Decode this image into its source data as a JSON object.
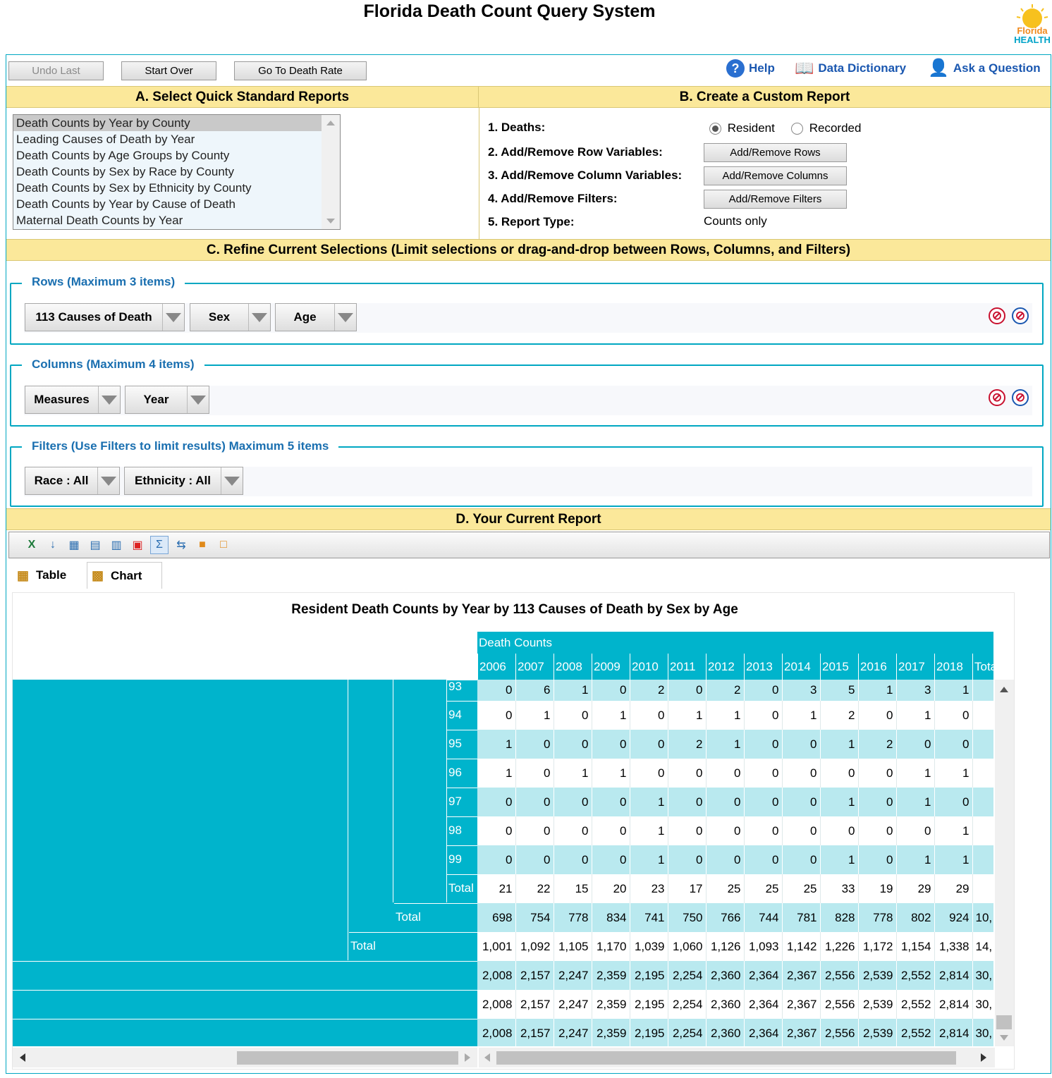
{
  "app": {
    "title": "Florida Death Count Query System",
    "logo_text_1": "Florida",
    "logo_text_2": "HEALTH"
  },
  "toolbar": {
    "undo_label": "Undo Last",
    "start_over_label": "Start Over",
    "death_rate_label": "Go To Death Rate",
    "help_label": "Help",
    "dictionary_label": "Data Dictionary",
    "ask_label": "Ask a Question"
  },
  "sectionA": {
    "header": "A. Select Quick Standard Reports",
    "reports": [
      "Death Counts by Year by County",
      "Leading Causes of Death by Year",
      "Death Counts by Age Groups by County",
      "Death Counts by Sex by Race by County",
      "Death Counts by Sex by Ethnicity by County",
      "Death Counts by Year by Cause of Death",
      "Maternal Death Counts by Year"
    ]
  },
  "sectionB": {
    "header": "B. Create a Custom Report",
    "deaths_label": "1. Deaths:",
    "resident_label": "Resident",
    "recorded_label": "Recorded",
    "rows_label": "2. Add/Remove Row Variables:",
    "rows_button": "Add/Remove Rows",
    "columns_label": "3. Add/Remove Column Variables:",
    "columns_button": "Add/Remove Columns",
    "filters_label": "4. Add/Remove Filters:",
    "filters_button": "Add/Remove Filters",
    "report_type_label": "5. Report Type:",
    "report_type_value": "Counts only"
  },
  "sectionC": {
    "header": "C. Refine Current Selections (Limit selections or drag-and-drop between Rows, Columns, and Filters)",
    "rows_legend": "Rows (Maximum 3 items)",
    "row_chips": [
      "113 Causes of Death",
      "Sex",
      "Age"
    ],
    "columns_legend": "Columns (Maximum 4 items)",
    "column_chips": [
      "Measures",
      "Year"
    ],
    "filters_legend": "Filters (Use Filters to limit results) Maximum 5 items",
    "filter_chips": [
      "Race : All",
      "Ethnicity : All"
    ]
  },
  "sectionD": {
    "header": "D. Your Current Report",
    "tab_table": "Table",
    "tab_chart": "Chart",
    "report_title": "Resident Death Counts by Year by 113 Causes of Death by Sex by Age",
    "measure_header": "Death Counts",
    "years": [
      "2006",
      "2007",
      "2008",
      "2009",
      "2010",
      "2011",
      "2012",
      "2013",
      "2014",
      "2015",
      "2016",
      "2017",
      "2018",
      "Tota"
    ],
    "rows": [
      {
        "label": "93",
        "values": [
          "0",
          "6",
          "1",
          "0",
          "2",
          "0",
          "2",
          "0",
          "3",
          "5",
          "1",
          "3",
          "1",
          ""
        ]
      },
      {
        "label": "94",
        "values": [
          "0",
          "1",
          "0",
          "1",
          "0",
          "1",
          "1",
          "0",
          "1",
          "2",
          "0",
          "1",
          "0",
          ""
        ]
      },
      {
        "label": "95",
        "values": [
          "1",
          "0",
          "0",
          "0",
          "0",
          "2",
          "1",
          "0",
          "0",
          "1",
          "2",
          "0",
          "0",
          ""
        ]
      },
      {
        "label": "96",
        "values": [
          "1",
          "0",
          "1",
          "1",
          "0",
          "0",
          "0",
          "0",
          "0",
          "0",
          "0",
          "1",
          "1",
          ""
        ]
      },
      {
        "label": "97",
        "values": [
          "0",
          "0",
          "0",
          "0",
          "1",
          "0",
          "0",
          "0",
          "0",
          "1",
          "0",
          "1",
          "0",
          ""
        ]
      },
      {
        "label": "98",
        "values": [
          "0",
          "0",
          "0",
          "0",
          "1",
          "0",
          "0",
          "0",
          "0",
          "0",
          "0",
          "0",
          "1",
          ""
        ]
      },
      {
        "label": "99",
        "values": [
          "0",
          "0",
          "0",
          "0",
          "1",
          "0",
          "0",
          "0",
          "0",
          "1",
          "0",
          "1",
          "1",
          ""
        ]
      },
      {
        "label": "Total",
        "values": [
          "21",
          "22",
          "15",
          "20",
          "23",
          "17",
          "25",
          "25",
          "25",
          "33",
          "19",
          "29",
          "29",
          ""
        ]
      },
      {
        "label": "Total",
        "values": [
          "698",
          "754",
          "778",
          "834",
          "741",
          "750",
          "766",
          "744",
          "781",
          "828",
          "778",
          "802",
          "924",
          "10,"
        ]
      },
      {
        "label": "Total",
        "values": [
          "1,001",
          "1,092",
          "1,105",
          "1,170",
          "1,039",
          "1,060",
          "1,126",
          "1,093",
          "1,142",
          "1,226",
          "1,172",
          "1,154",
          "1,338",
          "14,"
        ]
      },
      {
        "label": "",
        "values": [
          "2,008",
          "2,157",
          "2,247",
          "2,359",
          "2,195",
          "2,254",
          "2,360",
          "2,364",
          "2,367",
          "2,556",
          "2,539",
          "2,552",
          "2,814",
          "30,"
        ]
      },
      {
        "label": "",
        "values": [
          "2,008",
          "2,157",
          "2,247",
          "2,359",
          "2,195",
          "2,254",
          "2,360",
          "2,364",
          "2,367",
          "2,556",
          "2,539",
          "2,552",
          "2,814",
          "30,"
        ]
      },
      {
        "label": "",
        "values": [
          "2,008",
          "2,157",
          "2,247",
          "2,359",
          "2,195",
          "2,254",
          "2,360",
          "2,364",
          "2,367",
          "2,556",
          "2,539",
          "2,552",
          "2,814",
          "30,"
        ]
      }
    ]
  },
  "colors": {
    "accent_teal": "#00b4cc",
    "section_yellow": "#fbe89a",
    "link_blue": "#1a57b0",
    "legend_blue": "#1a6fb0"
  }
}
